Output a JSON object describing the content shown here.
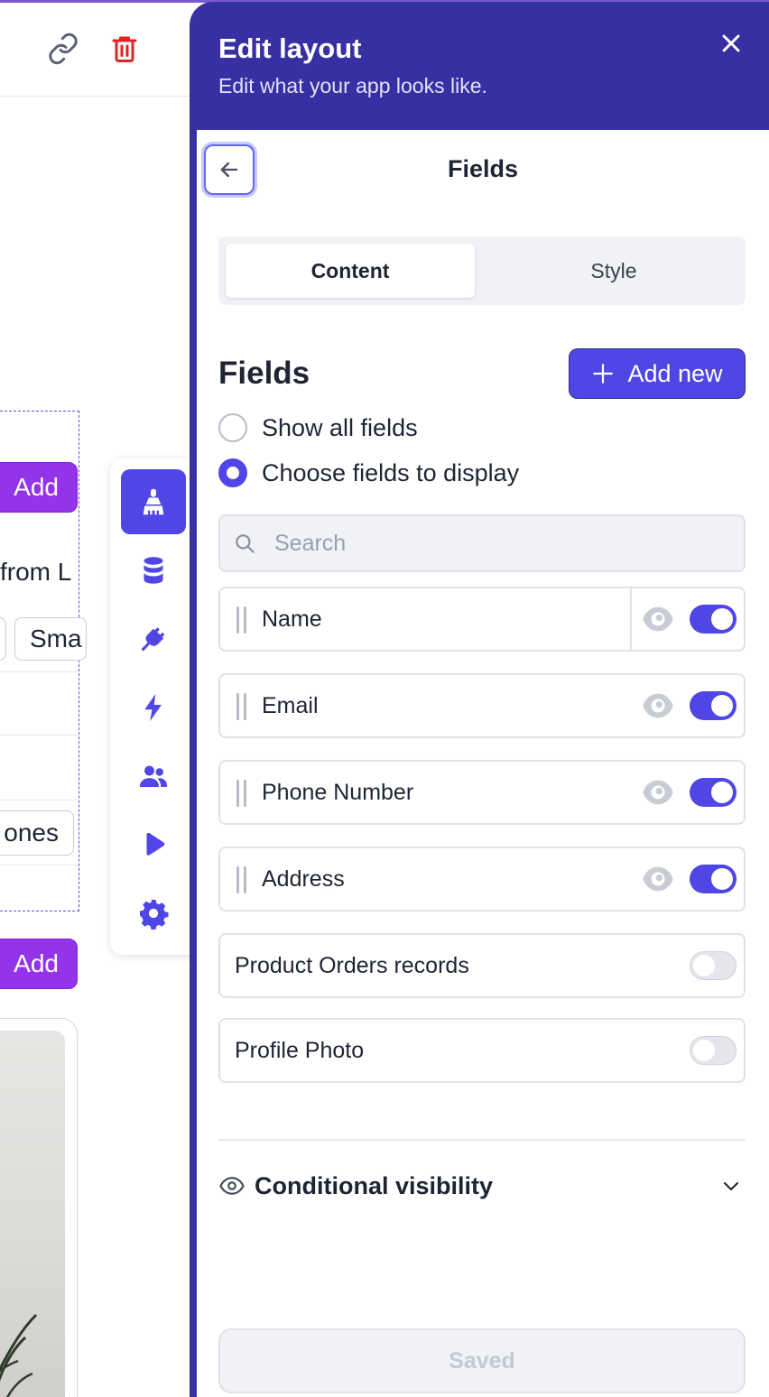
{
  "background": {
    "add_label": "Add",
    "text_fragment": "from L",
    "chip_label": "Sma",
    "chip_phones": "ones"
  },
  "toolbar": {
    "items": [
      {
        "icon": "paint-brush-icon",
        "active": true
      },
      {
        "icon": "database-icon",
        "active": false
      },
      {
        "icon": "plug-icon",
        "active": false
      },
      {
        "icon": "lightning-icon",
        "active": false
      },
      {
        "icon": "users-icon",
        "active": false
      },
      {
        "icon": "play-icon",
        "active": false
      },
      {
        "icon": "gear-icon",
        "active": false
      }
    ]
  },
  "panel": {
    "title": "Edit layout",
    "subtitle": "Edit what your app looks like.",
    "body_title": "Fields",
    "tabs": [
      {
        "label": "Content",
        "active": true
      },
      {
        "label": "Style",
        "active": false
      }
    ],
    "section_title": "Fields",
    "add_new_label": "Add new",
    "radio_options": [
      {
        "label": "Show all fields",
        "checked": false
      },
      {
        "label": "Choose fields to display",
        "checked": true
      }
    ],
    "search_placeholder": "Search",
    "fields": [
      {
        "label": "Name",
        "visible": true,
        "draggable": true
      },
      {
        "label": "Email",
        "visible": true,
        "draggable": true
      },
      {
        "label": "Phone Number",
        "visible": true,
        "draggable": true
      },
      {
        "label": "Address",
        "visible": true,
        "draggable": true
      },
      {
        "label": "Product Orders records",
        "visible": false,
        "draggable": false
      },
      {
        "label": "Profile Photo",
        "visible": false,
        "draggable": false
      }
    ],
    "conditional_visibility_label": "Conditional visibility",
    "saved_label": "Saved"
  },
  "colors": {
    "panel_header": "#3730a3",
    "accent": "#4f46e5",
    "background_add_button": "#9333ea",
    "delete_icon": "#dc2626"
  }
}
